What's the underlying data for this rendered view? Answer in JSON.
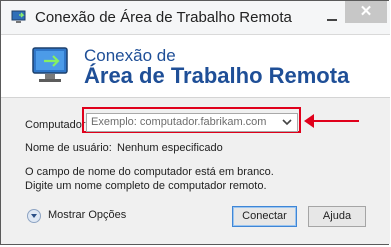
{
  "window": {
    "title": "Conexão de Área de Trabalho Remota",
    "close_glyph": "✕"
  },
  "banner": {
    "line1": "Conexão de",
    "line2": "Área de Trabalho Remota"
  },
  "form": {
    "computer_label": "Computador:",
    "computer_placeholder": "Exemplo: computador.fabrikam.com",
    "username_label": "Nome de usuário:",
    "username_value": "Nenhum especificado",
    "info_text": "O campo de nome do computador está em branco. Digite um nome completo de computador remoto."
  },
  "footer": {
    "options_label": "Mostrar Opções",
    "connect_label": "Conectar",
    "help_label": "Ajuda"
  },
  "colors": {
    "accent": "#1f4f97",
    "highlight": "#e0001b"
  },
  "icons": {
    "app": "remote-desktop-icon",
    "banner": "monitor-connection-icon",
    "dropdown": "chevron-down-icon",
    "options": "expand-circle-icon"
  }
}
